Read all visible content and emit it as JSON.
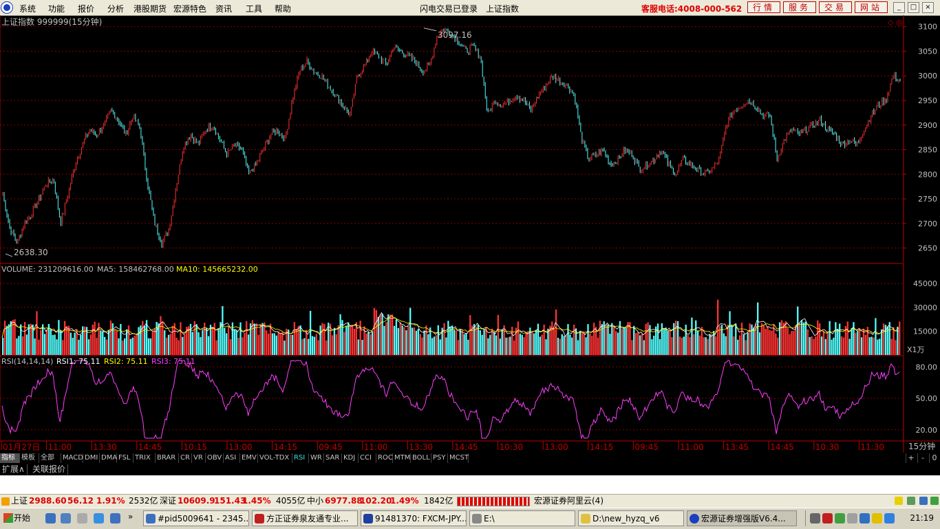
{
  "menubar": {
    "items": [
      "系统",
      "功能",
      "报价",
      "分析",
      "港股期货",
      "宏源特色",
      "资讯",
      "工具",
      "帮助"
    ],
    "login_status": "闪电交易已登录",
    "current_index": "上证指数",
    "hotline": "客服电话:4008-000-562",
    "nav_buttons": [
      "行情",
      "服务",
      "交易",
      "网站"
    ],
    "window_buttons": [
      "_",
      "□",
      "×"
    ]
  },
  "chart": {
    "title": "上证指数 999999(15分钟)",
    "high_label": "3097.16",
    "low_label": "2638.30",
    "price_axis": [
      "3100",
      "3050",
      "3000",
      "2950",
      "2900",
      "2850",
      "2800",
      "2750",
      "2700",
      "2650"
    ],
    "volume_line": {
      "vol": "VOLUME: 231209616.00",
      "ma5": "MA5: 158462768.00",
      "ma10": "MA10: 145665232.00"
    },
    "volume_axis": [
      "45000",
      "30000",
      "15000"
    ],
    "volume_unit": "X1万",
    "rsi_line": {
      "name": "RSI(14,14,14)",
      "rsi1": "RSI1: 75.11",
      "rsi2": "RSI2: 75.11",
      "rsi3": "RSI3: 75.11"
    },
    "rsi_axis": [
      "80.00",
      "50.00",
      "20.00"
    ],
    "time_axis": [
      "01月27日",
      "11:00",
      "13:30",
      "14:45",
      "10:15",
      "13:00",
      "14:15",
      "09:45",
      "11:00",
      "13:30",
      "14:45",
      "10:30",
      "13:00",
      "14:15",
      "09:45",
      "11:00",
      "13:45",
      "14:45",
      "10:30",
      "11:30"
    ],
    "period": "15分钟",
    "colors": {
      "up": "#ff3232",
      "down": "#54ffff",
      "grid": "#8b0000",
      "axis_text": "#c0c0c0",
      "ma5": "#ffffff",
      "ma10": "#ffff00",
      "rsi": "#ff40ff"
    }
  },
  "chart_data": {
    "type": "candlestick",
    "title": "上证指数 999999(15分钟)",
    "ylim": [
      2620,
      3115
    ],
    "high": 3097.16,
    "low": 2638.3,
    "close_path": [
      2760,
      2690,
      2660,
      2700,
      2720,
      2750,
      2780,
      2790,
      2700,
      2760,
      2820,
      2860,
      2890,
      2880,
      2900,
      2930,
      2910,
      2880,
      2920,
      2890,
      2780,
      2700,
      2660,
      2690,
      2780,
      2860,
      2880,
      2860,
      2890,
      2900,
      2870,
      2840,
      2860,
      2850,
      2800,
      2820,
      2850,
      2880,
      2890,
      2870,
      2950,
      3010,
      3030,
      3010,
      3000,
      2980,
      2960,
      2940,
      2920,
      3000,
      3020,
      3050,
      3040,
      3020,
      3060,
      3050,
      3040,
      3030,
      3010,
      3020,
      3080,
      3095,
      3085,
      3070,
      3050,
      3060,
      3040,
      2920,
      2950,
      2940,
      2950,
      2960,
      2950,
      2930,
      2960,
      2980,
      3000,
      2990,
      2980,
      2960,
      2870,
      2830,
      2840,
      2850,
      2820,
      2830,
      2850,
      2840,
      2810,
      2820,
      2830,
      2850,
      2820,
      2800,
      2830,
      2820,
      2810,
      2800,
      2810,
      2830,
      2900,
      2930,
      2940,
      2950,
      2940,
      2920,
      2920,
      2830,
      2870,
      2890,
      2880,
      2890,
      2900,
      2910,
      2890,
      2880,
      2860,
      2870,
      2860,
      2890,
      2920,
      2940,
      2950,
      3000,
      2990
    ],
    "volume": {
      "vol": 231209616.0,
      "ma5": 158462768.0,
      "ma10": 145665232.0,
      "ylim_wan": [
        0,
        52000
      ]
    },
    "rsi": {
      "rsi1": 75.11,
      "rsi2": 75.11,
      "rsi3": 75.11,
      "ylim": [
        10,
        90
      ]
    }
  },
  "indicator_tabs": [
    "指标",
    "模板",
    "全部",
    "MACD",
    "DMI",
    "DMA",
    "FSL",
    "TRIX",
    "BRAR",
    "CR",
    "VR",
    "OBV",
    "ASI",
    "EMV",
    "VOL-TDX",
    "RSI",
    "WR",
    "SAR",
    "KDJ",
    "CCI",
    "ROC",
    "MTM",
    "BOLL",
    "PSY",
    "MCST"
  ],
  "selected_indicator": "RSI",
  "tab_controls": [
    "+",
    "-",
    "0"
  ],
  "ext_tabs": [
    "扩展∧",
    "关联报价"
  ],
  "quotes": {
    "sh_label": "上证",
    "sh_price": "2988.60",
    "sh_chg": "56.12",
    "sh_pct": "1.91%",
    "sh_amt": "2532亿",
    "sz_label": "深证",
    "sz_price": "10609.9",
    "sz_chg": "151.43",
    "sz_pct": "1.45%",
    "sz_amt": "4055亿",
    "zx_label": "中小",
    "zx_price": "6977.88",
    "zx_chg": "102.20",
    "zx_pct": "1.49%",
    "zx_amt": "1842亿",
    "server": "宏源证券阿里云(4)"
  },
  "taskbar": {
    "start": "开始",
    "tasks": [
      "#pid5009641 - 2345...",
      "方正证券泉友通专业...",
      "91481370: FXCM-JPY...",
      "E:\\",
      "D:\\new_hyzq_v6",
      "宏源证券增强版V6.4..."
    ],
    "clock": "21:19"
  }
}
